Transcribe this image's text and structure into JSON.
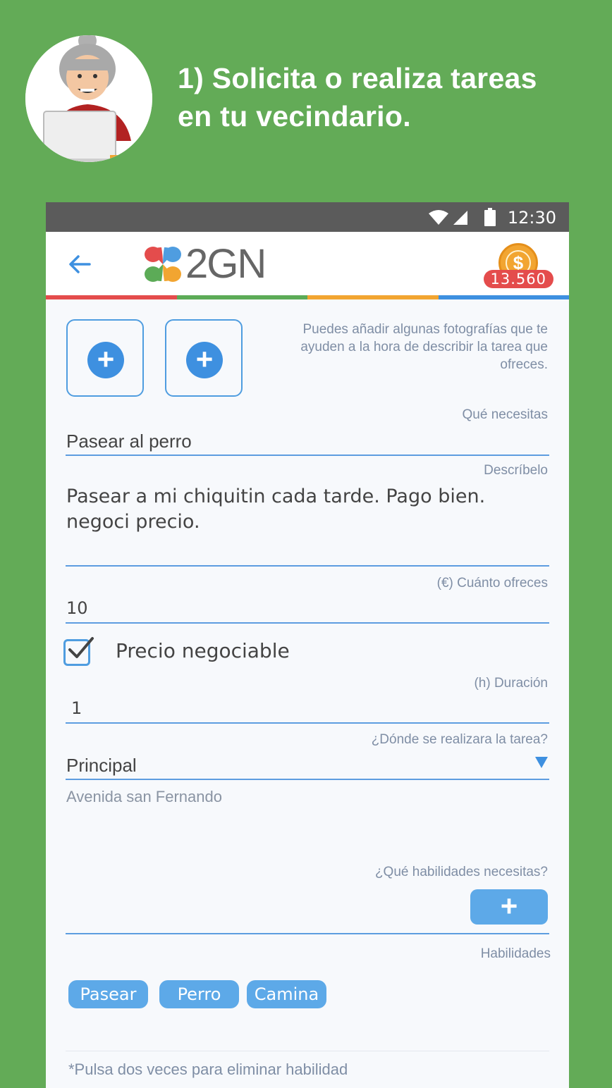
{
  "promo": {
    "title_line1": "1) Solicita o realiza tareas",
    "title_line2": "en tu vecindario."
  },
  "status_bar": {
    "time": "12:30",
    "icons": [
      "wifi-icon",
      "signal-icon",
      "battery-icon"
    ]
  },
  "app_bar": {
    "back_icon": "arrow-left-icon",
    "logo_text": "2GN",
    "coins": "13.560",
    "coin_icon": "dollar-coin-icon"
  },
  "photos": {
    "hint": "Puedes añadir algunas fotografías que te ayuden a la hora de describir la tarea que ofreces."
  },
  "form": {
    "need_label": "Qué necesitas",
    "need_value": "Pasear al perro",
    "describe_label": "Descríbelo",
    "describe_value_line1": "Pasear a mi chiquitin cada tarde. Pago bien.",
    "describe_value_line2": "negoci precio.",
    "offer_label": "(€) Cuánto  ofreces",
    "offer_value": "10",
    "negotiable_label": "Precio negociable",
    "negotiable_checked": true,
    "duration_label": "(h) Duración",
    "duration_value": "1",
    "where_label": "¿Dónde se realizara la tarea?",
    "where_value": "Principal",
    "where_address": "Avenida san Fernando",
    "skills_needed_label": "¿Qué habilidades necesitas?",
    "add_skill": "+",
    "skills_label": "Habilidades",
    "skills": [
      "Pasear",
      "Perro",
      "Camina"
    ],
    "footer_note": "*Pulsa dos veces para eliminar habilidad"
  },
  "colors": {
    "background": "#63ab57",
    "accent_blue": "#3e90e0",
    "strip": [
      "#e44c4c",
      "#5cab57",
      "#f2a531",
      "#3e90e0"
    ]
  }
}
